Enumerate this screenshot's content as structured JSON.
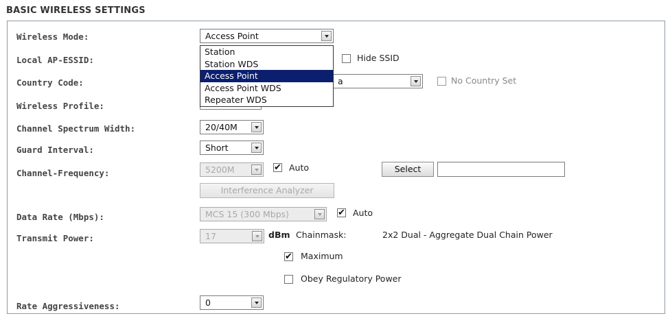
{
  "section_title": "BASIC WIRELESS SETTINGS",
  "wireless_mode": {
    "label": "Wireless Mode:",
    "value": "Access Point",
    "options": [
      "Station",
      "Station WDS",
      "Access Point",
      "Access Point WDS",
      "Repeater WDS"
    ],
    "selected_index": 2
  },
  "local_essid": {
    "label": "Local AP-ESSID:",
    "hide_ssid_label": "Hide SSID",
    "hide_ssid_checked": false
  },
  "country_code": {
    "label": "Country Code:",
    "value_fragment": "a",
    "no_country_label": "No Country Set",
    "no_country_checked": false
  },
  "wireless_profile": {
    "label": "Wireless Profile:"
  },
  "channel_width": {
    "label": "Channel Spectrum Width:",
    "value": "20/40M"
  },
  "guard_interval": {
    "label": "Guard Interval:",
    "value": "Short"
  },
  "channel_frequency": {
    "label": "Channel-Frequency:",
    "value": "5200M",
    "auto_label": "Auto",
    "auto_checked": true,
    "select_button": "Select",
    "select_value": "",
    "analyzer_button": "Interference Analyzer"
  },
  "data_rate": {
    "label": "Data Rate (Mbps):",
    "value": "MCS 15 (300 Mbps)",
    "auto_label": "Auto",
    "auto_checked": true
  },
  "transmit_power": {
    "label": "Transmit Power:",
    "value": "17",
    "unit": "dBm",
    "chainmask_label": "Chainmask:",
    "chainmask_value": "2x2 Dual - Aggregate Dual Chain Power",
    "maximum_label": "Maximum",
    "maximum_checked": true,
    "obey_label": "Obey Regulatory Power",
    "obey_checked": false
  },
  "rate_aggressiveness": {
    "label": "Rate Aggressiveness:",
    "value": "0"
  },
  "check_mark": "✔"
}
